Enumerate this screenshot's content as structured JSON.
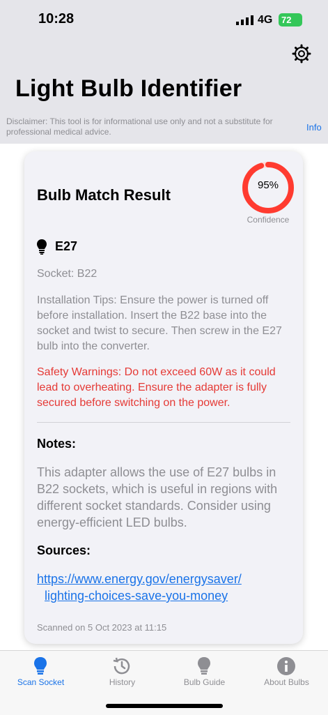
{
  "status_bar": {
    "time": "10:28",
    "network": "4G",
    "battery": "72"
  },
  "header": {
    "title": "Light Bulb Identifier",
    "disclaimer": "Disclaimer: This tool is for informational use only and not a substitute for professional medical advice.",
    "info_label": "Info"
  },
  "result": {
    "title": "Bulb Match Result",
    "confidence_value": "95%",
    "confidence_fraction": 0.95,
    "confidence_label": "Confidence",
    "bulb_type": "E27",
    "socket": "Socket: B22",
    "installation_tips": "Installation Tips: Ensure the power is turned off before installation. Insert the B22 base into the socket and twist to secure. Then screw in the E27 bulb into the converter.",
    "safety_warnings": "Safety Warnings: Do not exceed 60W as it could lead to overheating. Ensure the adapter is fully secured before switching on the power.",
    "notes_heading": "Notes:",
    "notes_body": "This adapter allows the use of E27 bulbs in B22 sockets, which is useful in regions with different socket standards. Consider using energy-efficient LED bulbs.",
    "sources_heading": "Sources:",
    "source_url": "https://www.energy.gov/energysaver/lighting-choices-save-you-money",
    "scanned": "Scanned on 5 Oct 2023 at 11:15"
  },
  "tabs": [
    {
      "label": "Scan Socket",
      "icon": "bulb-icon",
      "active": true
    },
    {
      "label": "History",
      "icon": "history-icon",
      "active": false
    },
    {
      "label": "Bulb Guide",
      "icon": "bulb-icon",
      "active": false
    },
    {
      "label": "About Bulbs",
      "icon": "info-icon",
      "active": false
    }
  ],
  "colors": {
    "accent": "#1a73e8",
    "ring": "#ff3b30",
    "warning": "#e53935",
    "battery": "#34c759"
  }
}
